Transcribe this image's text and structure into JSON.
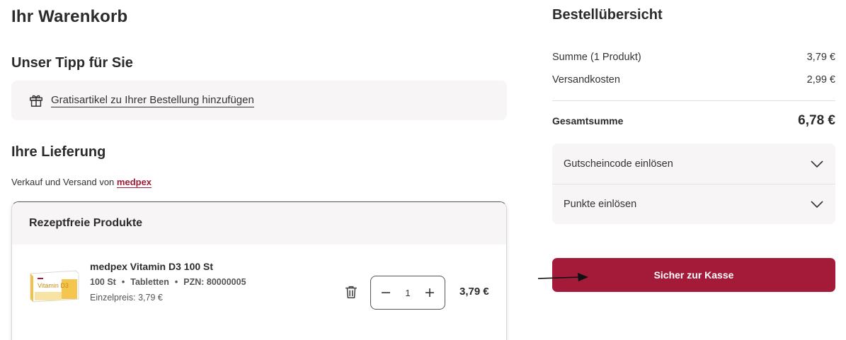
{
  "cart": {
    "title": "Ihr Warenkorb",
    "tip_heading": "Unser Tipp für Sie",
    "gift_link": "Gratisartikel zu Ihrer Bestellung hinzufügen",
    "delivery_heading": "Ihre Lieferung",
    "seller_prefix": "Verkauf und Versand von",
    "seller_name": "medpex",
    "section_title": "Rezeptfreie Produkte",
    "product": {
      "name": "medpex Vitamin D3 100 St",
      "amount": "100 St",
      "form": "Tabletten",
      "pzn": "PZN: 80000005",
      "dot": "•",
      "unit_price": "Einzelpreis: 3,79 €",
      "quantity": "1",
      "price": "3,79 €",
      "image_brand": "Vitamin D3"
    }
  },
  "summary": {
    "title": "Bestellübersicht",
    "subtotal_label": "Summe (1 Produkt)",
    "subtotal_value": "3,79 €",
    "shipping_label": "Versandkosten",
    "shipping_value": "2,99 €",
    "total_label": "Gesamtsumme",
    "total_value": "6,78 €",
    "coupon_label": "Gutscheincode einlösen",
    "points_label": "Punkte einlösen",
    "checkout_label": "Sicher zur Kasse"
  },
  "colors": {
    "brand": "#a31b38",
    "panel": "#f7f5f5",
    "text": "#2b2b2b"
  }
}
